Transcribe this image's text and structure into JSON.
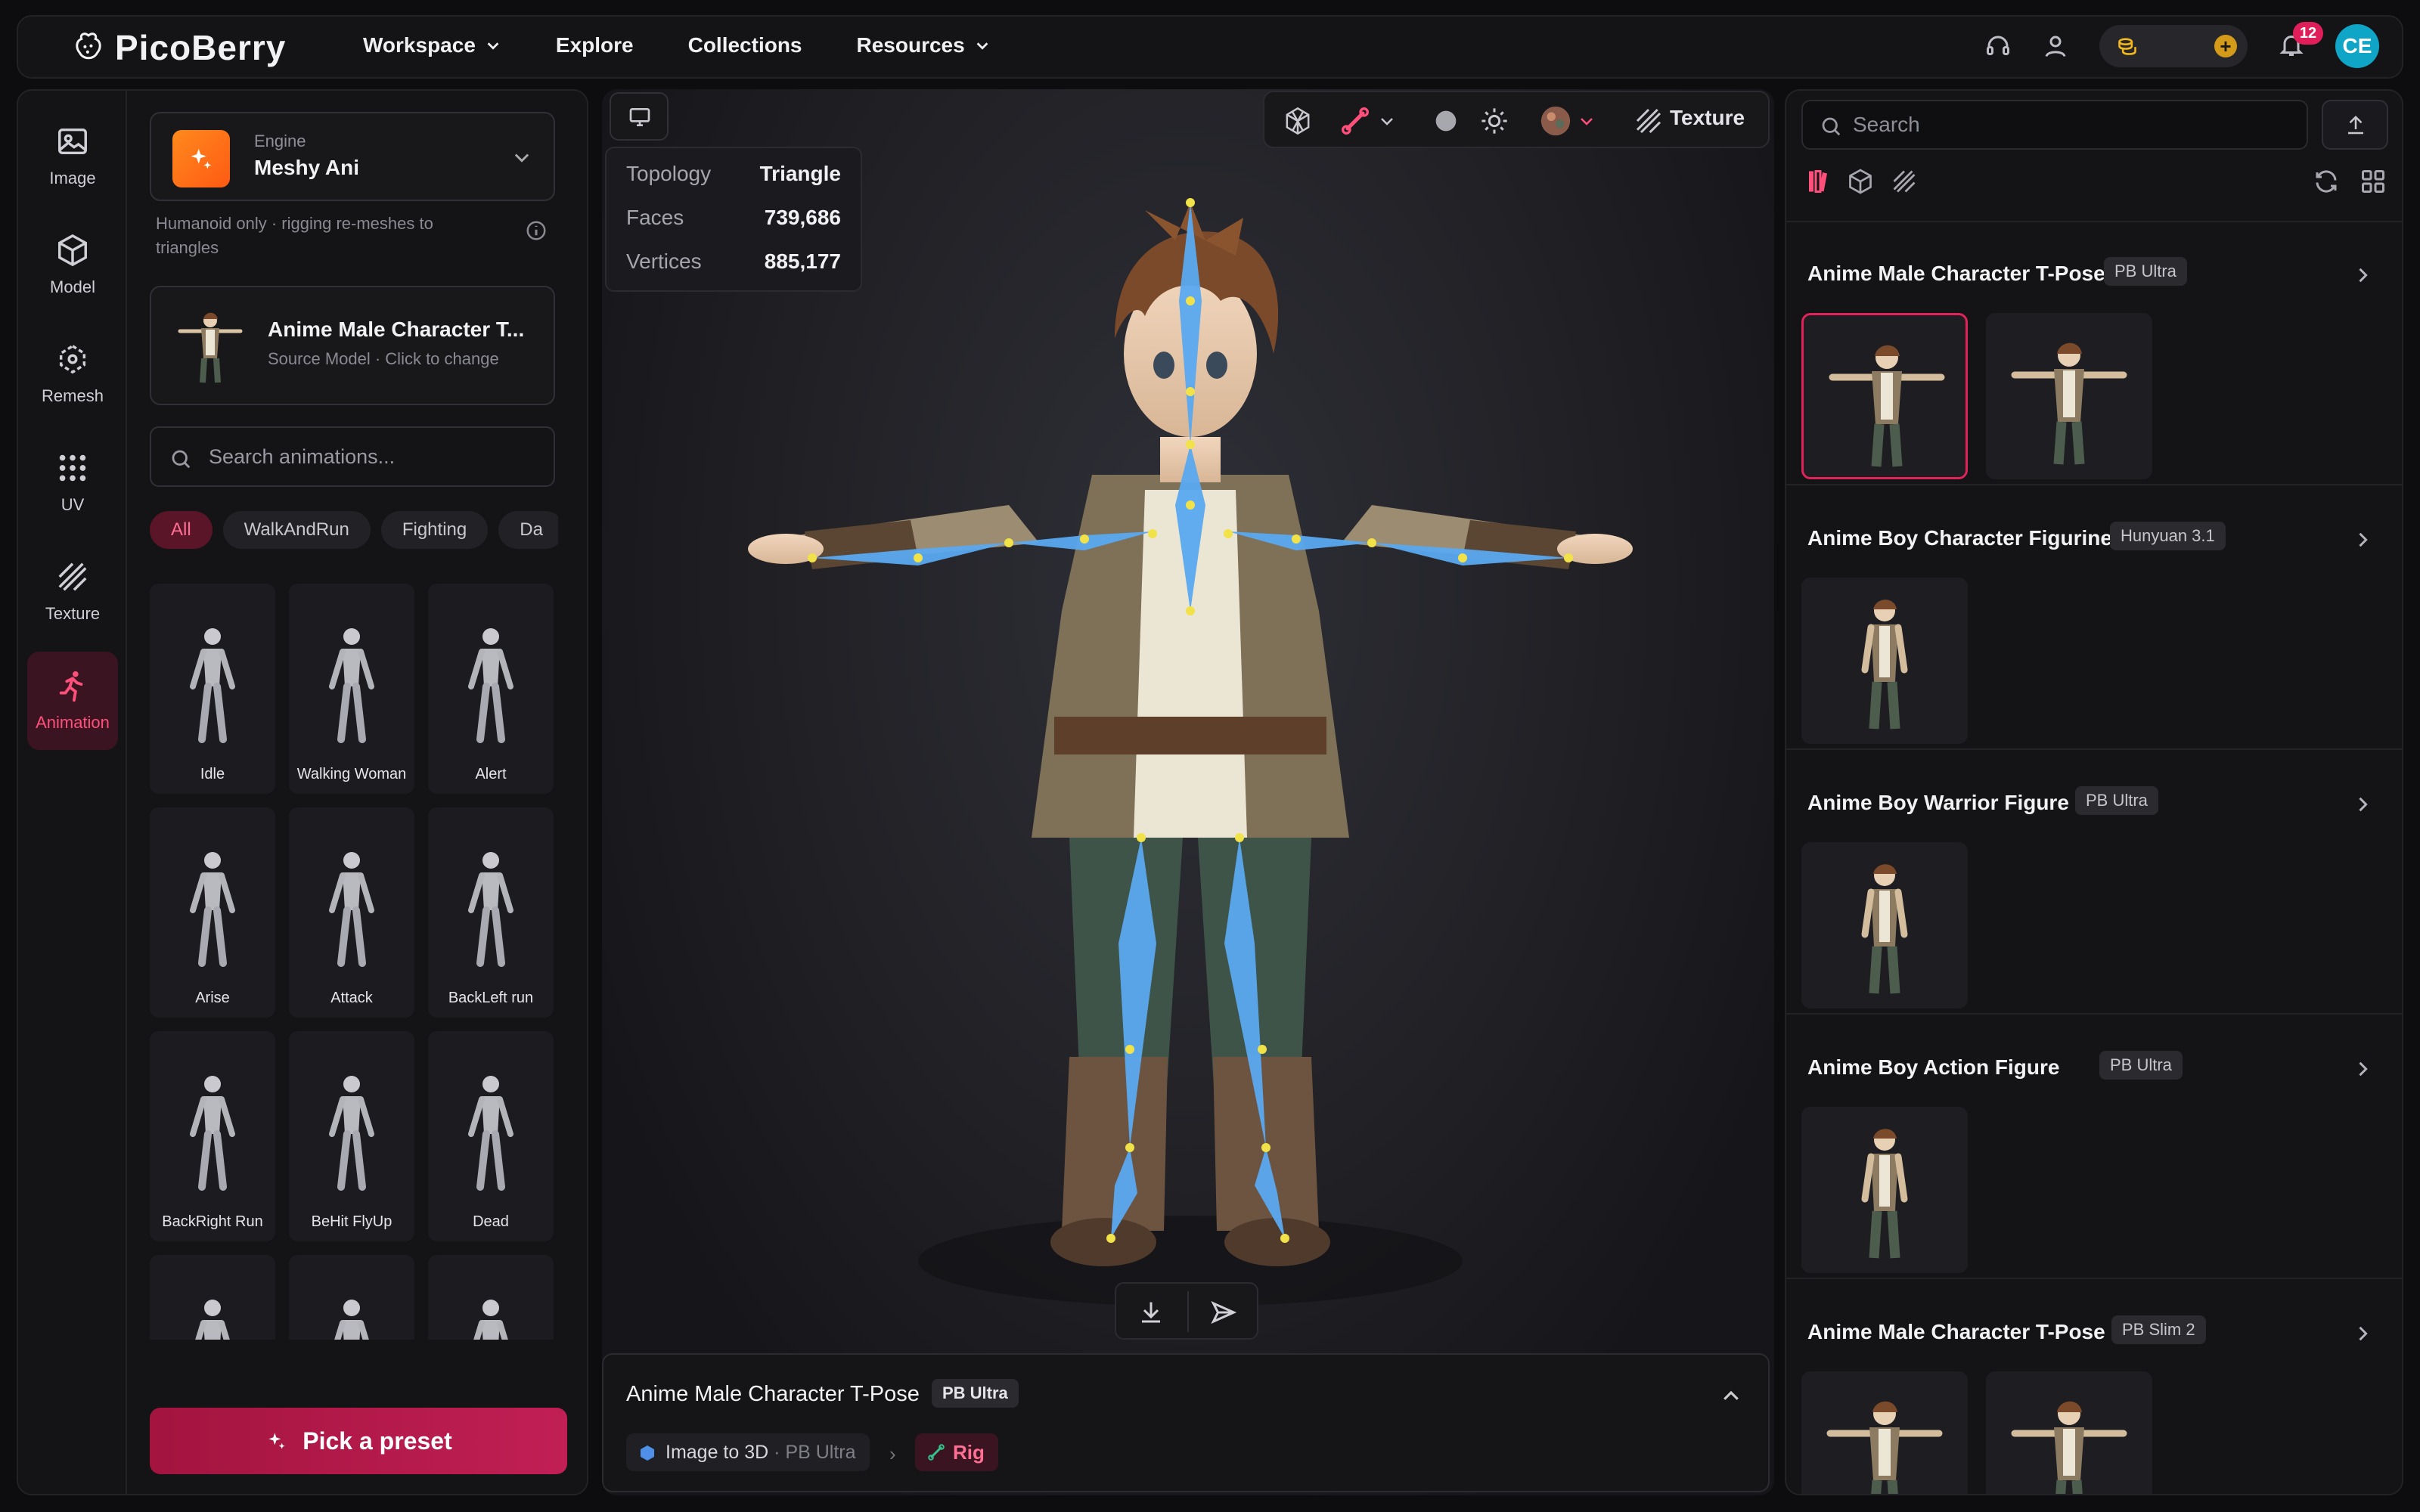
{
  "app": {
    "name": "PicoBerry"
  },
  "nav": [
    {
      "label": "Workspace",
      "dropdown": true
    },
    {
      "label": "Explore",
      "dropdown": false
    },
    {
      "label": "Collections",
      "dropdown": false
    },
    {
      "label": "Resources",
      "dropdown": true
    }
  ],
  "topbar": {
    "notification_count": "12",
    "avatar_initials": "CE",
    "icons": [
      "headset-icon",
      "user-icon",
      "coins-icon",
      "plus-icon",
      "bell-icon"
    ]
  },
  "rail": [
    {
      "label": "Image",
      "icon": "image-icon"
    },
    {
      "label": "Model",
      "icon": "cube-icon"
    },
    {
      "label": "Remesh",
      "icon": "remesh-icon"
    },
    {
      "label": "UV",
      "icon": "grid-dots-icon"
    },
    {
      "label": "Texture",
      "icon": "texture-icon"
    },
    {
      "label": "Animation",
      "icon": "running-icon",
      "active": true
    }
  ],
  "engine": {
    "label": "Engine",
    "name": "Meshy Ani",
    "hint": "Humanoid only · rigging re-meshes to triangles"
  },
  "source": {
    "title": "Anime Male Character T...",
    "subtitle": "Source Model · Click to change"
  },
  "anim_search": {
    "placeholder": "Search animations..."
  },
  "chips": [
    {
      "label": "All",
      "active": true
    },
    {
      "label": "WalkAndRun"
    },
    {
      "label": "Fighting"
    },
    {
      "label": "Da"
    }
  ],
  "animations": [
    {
      "label": "Idle"
    },
    {
      "label": "Walking Woman"
    },
    {
      "label": "Alert"
    },
    {
      "label": "Arise"
    },
    {
      "label": "Attack"
    },
    {
      "label": "BackLeft run"
    },
    {
      "label": "BackRight Run"
    },
    {
      "label": "BeHit FlyUp"
    },
    {
      "label": "Dead"
    },
    {
      "label": ""
    },
    {
      "label": ""
    },
    {
      "label": ""
    }
  ],
  "preset_button": "Pick a preset",
  "viewport": {
    "stats": [
      {
        "key": "Topology",
        "value": "Triangle"
      },
      {
        "key": "Faces",
        "value": "739,686"
      },
      {
        "key": "Vertices",
        "value": "885,177"
      }
    ],
    "toolbar": {
      "texture_label": "Texture"
    }
  },
  "model_bar": {
    "title": "Anime Male Character T-Pose",
    "tag": "PB Ultra",
    "step1": "Image to 3D",
    "step1_engine": "· PB Ultra",
    "step2": "Rig"
  },
  "right_panel": {
    "search_placeholder": "Search",
    "groups": [
      {
        "title": "Anime Male Character T-Pose",
        "tag": "PB Ultra",
        "thumbs": [
          "tpose",
          "tpose"
        ],
        "selected": 0
      },
      {
        "title": "Anime Boy Character Figurine",
        "tag": "Hunyuan 3.1",
        "thumbs": [
          "stand"
        ]
      },
      {
        "title": "Anime Boy Warrior Figure",
        "tag": "PB Ultra",
        "thumbs": [
          "stand"
        ]
      },
      {
        "title": "Anime Boy Action Figure",
        "tag": "PB Ultra",
        "thumbs": [
          "stand"
        ]
      },
      {
        "title": "Anime Male Character T-Pose",
        "tag": "PB Slim 2",
        "thumbs": [
          "tpose",
          "tpose"
        ]
      }
    ]
  },
  "colors": {
    "accent": "#e0245a",
    "accent_text": "#ff4f7b",
    "bone": "#5aa9f0",
    "joint": "#f2e24a"
  }
}
